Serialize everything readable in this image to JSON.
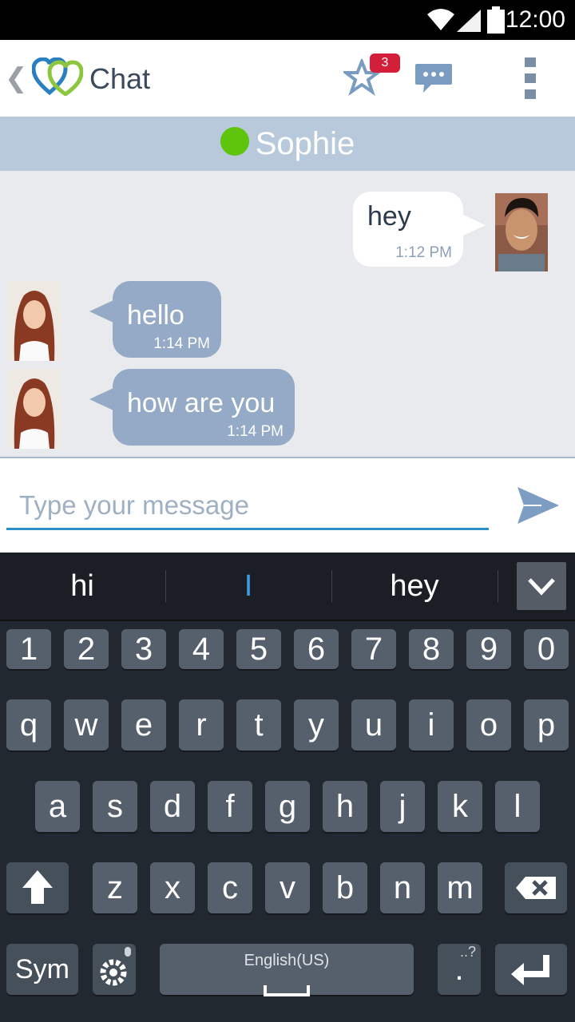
{
  "status_bar": {
    "time": "12:00"
  },
  "app_bar": {
    "back_glyph": "❮",
    "title": "Chat",
    "favorites_badge": "3"
  },
  "contact": {
    "name": "Sophie",
    "status_color": "#5ec40c"
  },
  "messages": [
    {
      "direction": "sent",
      "text": "hey",
      "time": "1:12 PM"
    },
    {
      "direction": "received",
      "text": "hello",
      "time": "1:14 PM"
    },
    {
      "direction": "received",
      "text": "how are you",
      "time": "1:14 PM"
    }
  ],
  "composer": {
    "placeholder": "Type your message",
    "value": ""
  },
  "keyboard": {
    "suggestions": [
      "hi",
      "I",
      "hey"
    ],
    "number_row": [
      "1",
      "2",
      "3",
      "4",
      "5",
      "6",
      "7",
      "8",
      "9",
      "0"
    ],
    "row1": [
      "q",
      "w",
      "e",
      "r",
      "t",
      "y",
      "u",
      "i",
      "o",
      "p"
    ],
    "row2": [
      "a",
      "s",
      "d",
      "f",
      "g",
      "h",
      "j",
      "k",
      "l"
    ],
    "row3": [
      "z",
      "x",
      "c",
      "v",
      "b",
      "n",
      "m"
    ],
    "sym_label": "Sym",
    "language_label": "English(US)",
    "period_label": ".",
    "period_hint": "..?"
  },
  "colors": {
    "accent_blue": "#2a90c8",
    "sent_bubble": "#ffffff",
    "received_bubble": "#94aac6",
    "contact_bar": "#b8c9dc",
    "badge": "#d41f3a"
  }
}
